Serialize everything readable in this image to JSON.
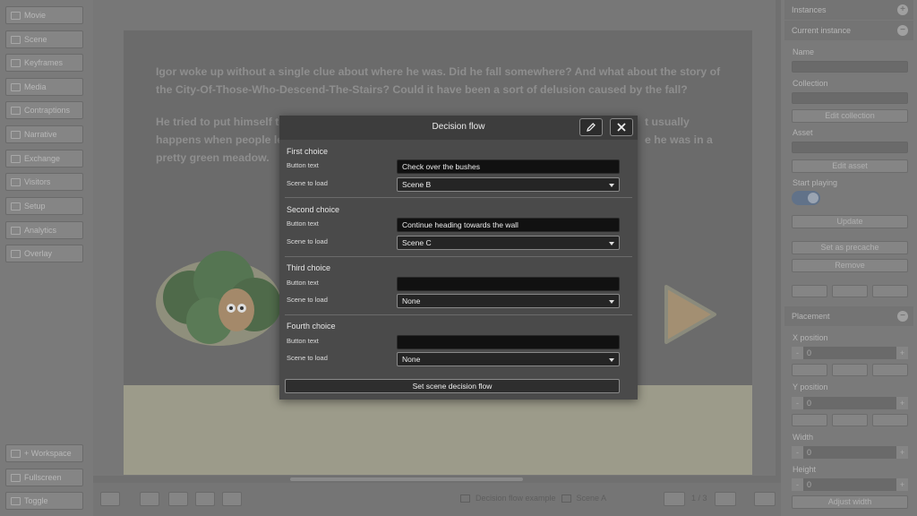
{
  "left_nav": {
    "items": [
      "Movie",
      "Scene",
      "Keyframes",
      "Media",
      "Contraptions",
      "Narrative",
      "Exchange",
      "Visitors",
      "Setup",
      "Analytics",
      "Overlay"
    ],
    "bottom": [
      "+ Workspace",
      "Fullscreen",
      "Toggle"
    ]
  },
  "stage": {
    "paragraph1": [
      "Igor woke up without a single clue about where he was. Did he fall somewhere? And what about the story of",
      "the City-Of-Those-Who-Descend-The-Stairs? Could it have been a sort of delusion caused by the fall?"
    ],
    "paragraph2_left": [
      "He tried to put himself to",
      "happens when people le",
      "pretty green meadow."
    ],
    "paragraph2_right": [
      "t usually",
      "e he was in a"
    ]
  },
  "bottom_bar": {
    "breadcrumb_movie": "Decision flow example",
    "breadcrumb_scene": "Scene A",
    "page_indicator": "1 / 3"
  },
  "right_panel": {
    "instances": "Instances",
    "current_instance": "Current instance",
    "name_label": "Name",
    "collection_label": "Collection",
    "edit_collection": "Edit collection",
    "asset_label": "Asset",
    "edit_asset": "Edit asset",
    "start_playing": "Start playing",
    "update": "Update",
    "set_precache": "Set as precache",
    "remove": "Remove",
    "placement": "Placement",
    "x_position_label": "X position",
    "x_value": "0",
    "y_position_label": "Y position",
    "y_value": "0",
    "width_label": "Width",
    "width_value": "0",
    "height_label": "Height",
    "height_value": "0",
    "adjust_width": "Adjust width",
    "minus": "-",
    "plus": "+"
  },
  "modal": {
    "title": "Decision flow",
    "button_text_label": "Button text",
    "scene_to_load_label": "Scene to load",
    "choices": [
      {
        "title": "First choice",
        "button_text": "Check over the bushes",
        "scene": "Scene B"
      },
      {
        "title": "Second choice",
        "button_text": "Continue heading towards the wall",
        "scene": "Scene C"
      },
      {
        "title": "Third choice",
        "button_text": "",
        "scene": "None"
      },
      {
        "title": "Fourth choice",
        "button_text": "",
        "scene": "None"
      }
    ],
    "submit": "Set scene decision flow"
  },
  "colors": {
    "modal_bg": "#4a4a4a",
    "modal_header": "#3d3d3d",
    "toggle_on": "#617289"
  }
}
